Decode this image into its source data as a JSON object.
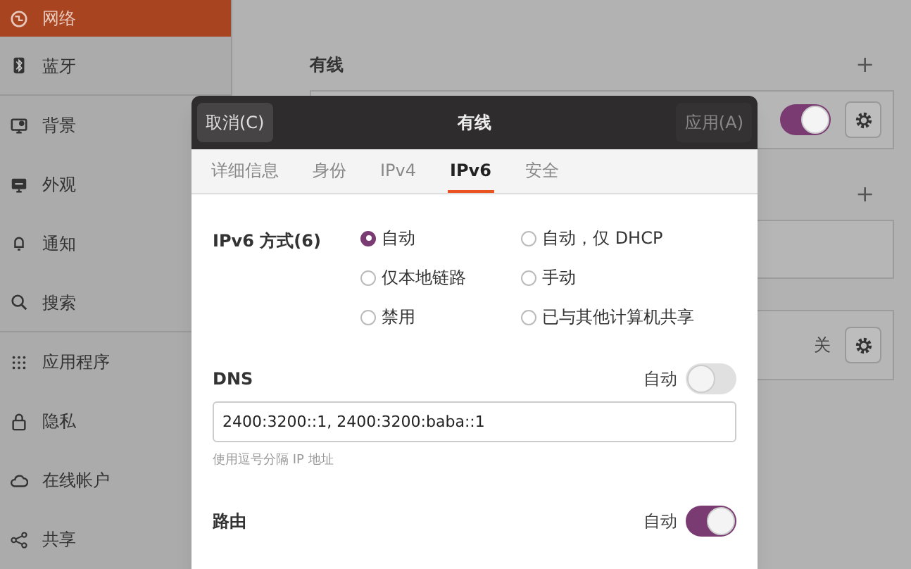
{
  "sidebar": {
    "items": [
      {
        "label": "网络",
        "selected": true
      },
      {
        "label": "蓝牙",
        "selected": false
      },
      {
        "label": "背景",
        "selected": false
      },
      {
        "label": "外观",
        "selected": false
      },
      {
        "label": "通知",
        "selected": false
      },
      {
        "label": "搜索",
        "selected": false
      },
      {
        "label": "应用程序",
        "selected": false
      },
      {
        "label": "隐私",
        "selected": false
      },
      {
        "label": "在线帐户",
        "selected": false
      },
      {
        "label": "共享",
        "selected": false
      }
    ]
  },
  "background_panel": {
    "sections": [
      {
        "title": "有线",
        "add_button": "+",
        "row": {
          "kind": "toggle",
          "on": true
        }
      },
      {
        "add_button": "+",
        "row": {
          "kind": "empty"
        }
      },
      {
        "row": {
          "kind": "status",
          "status": "关"
        }
      }
    ]
  },
  "dialog": {
    "title": "有线",
    "cancel": "取消(C)",
    "apply": {
      "label": "应用(A)",
      "disabled": true
    },
    "tabs": [
      {
        "label": "详细信息",
        "selected": false
      },
      {
        "label": "身份",
        "selected": false
      },
      {
        "label": "IPv4",
        "selected": false
      },
      {
        "label": "IPv6",
        "selected": true
      },
      {
        "label": "安全",
        "selected": false
      }
    ],
    "ipv6_method": {
      "label": "IPv6 方式(6)",
      "options": [
        {
          "label": "自动",
          "selected": true
        },
        {
          "label": "自动，仅 DHCP",
          "selected": false
        },
        {
          "label": "仅本地链路",
          "selected": false
        },
        {
          "label": "手动",
          "selected": false
        },
        {
          "label": "禁用",
          "selected": false
        },
        {
          "label": "已与其他计算机共享",
          "selected": false
        }
      ]
    },
    "dns": {
      "label": "DNS",
      "auto_label": "自动",
      "auto": false,
      "value": "2400:3200::1, 2400:3200:baba::1",
      "hint": "使用逗号分隔 IP 地址"
    },
    "routes": {
      "label": "路由",
      "auto_label": "自动",
      "auto": true
    }
  }
}
